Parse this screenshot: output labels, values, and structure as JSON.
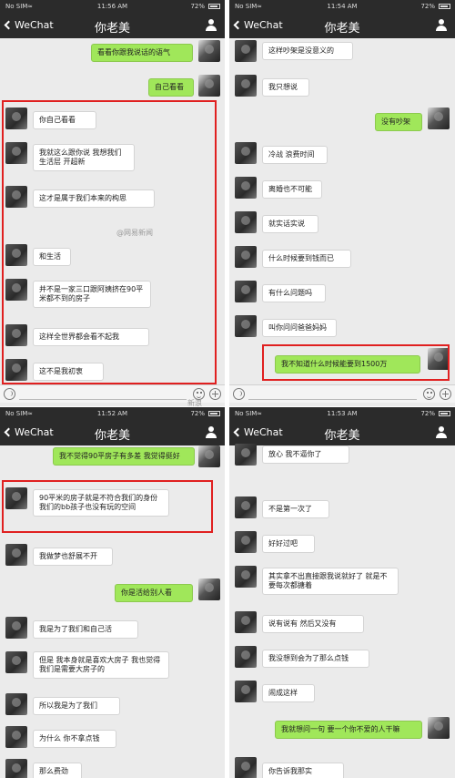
{
  "panels": [
    {
      "carrier": "No SIM",
      "time": "11:56 AM",
      "battery": "72%",
      "back": "WeChat",
      "title": "你老美",
      "messages": [
        {
          "from": "me",
          "text": "看看你跟我说话的语气"
        },
        {
          "from": "me",
          "text": "自己看看"
        },
        {
          "from": "them",
          "text": "你自己看看"
        },
        {
          "from": "them",
          "text": "我就这么跟你说 我想我们生活层 开超新"
        },
        {
          "from": "them",
          "text": "这才是属于我们本来的构思"
        },
        {
          "from": "them",
          "text": "和生活"
        },
        {
          "from": "them",
          "text": "并不是一家三口跟阿姨挤在90平米都不到的房子"
        },
        {
          "from": "them",
          "text": "这样全世界都会看不起我"
        },
        {
          "from": "them",
          "text": "这不是我初衷"
        }
      ]
    },
    {
      "carrier": "No SIM",
      "time": "11:54 AM",
      "battery": "72%",
      "back": "WeChat",
      "title": "你老美",
      "messages": [
        {
          "from": "them",
          "text": "这样吵架是没意义的"
        },
        {
          "from": "them",
          "text": "我只想说"
        },
        {
          "from": "me",
          "text": "没有吵架"
        },
        {
          "from": "them",
          "text": "冷战 浪费时间"
        },
        {
          "from": "them",
          "text": "离婚也不可能"
        },
        {
          "from": "them",
          "text": "就实话实说"
        },
        {
          "from": "them",
          "text": "什么时候要到钱而已"
        },
        {
          "from": "them",
          "text": "有什么问题吗"
        },
        {
          "from": "them",
          "text": "叫你问问爸爸妈妈"
        },
        {
          "from": "me",
          "text": "我不知道什么时候能要到1500万"
        }
      ]
    },
    {
      "carrier": "No SIM",
      "time": "11:52 AM",
      "battery": "72%",
      "back": "WeChat",
      "title": "你老美",
      "messages": [
        {
          "from": "me",
          "text": "我不觉得90平房子有多差 我觉得挺好"
        },
        {
          "from": "them",
          "text": "90平米的房子就是不符合我们的身份 我们的bb孩子也没有玩的空间"
        },
        {
          "from": "them",
          "text": "我做梦也舒展不开"
        },
        {
          "from": "me",
          "text": "你是活给别人看"
        },
        {
          "from": "them",
          "text": "我是为了我们和自己活"
        },
        {
          "from": "them",
          "text": "但是 我本身就是喜欢大房子 我也觉得我们是需要大房子的"
        },
        {
          "from": "them",
          "text": "所以我是为了我们"
        },
        {
          "from": "them",
          "text": "为什么 你不拿点钱"
        },
        {
          "from": "them",
          "text": "那么费劲"
        }
      ]
    },
    {
      "carrier": "No SIM",
      "time": "11:53 AM",
      "battery": "72%",
      "back": "WeChat",
      "title": "你老美",
      "messages": [
        {
          "from": "them",
          "text": "放心 我不逼你了"
        },
        {
          "from": "them",
          "text": "不是第一次了"
        },
        {
          "from": "them",
          "text": "好好过吧"
        },
        {
          "from": "them",
          "text": "其实拿不出直接跟我说就好了 就是不要每次都搪着"
        },
        {
          "from": "them",
          "text": "说有说有 然后又没有"
        },
        {
          "from": "them",
          "text": "我没想到会为了那么点钱"
        },
        {
          "from": "them",
          "text": "闹成这样"
        },
        {
          "from": "me",
          "text": "我就想问一句 要一个你不爱的人干嘛"
        },
        {
          "from": "them",
          "text": "你告诉我那实"
        }
      ]
    }
  ],
  "watermarks": [
    "新浪",
    "@网易新闻"
  ]
}
